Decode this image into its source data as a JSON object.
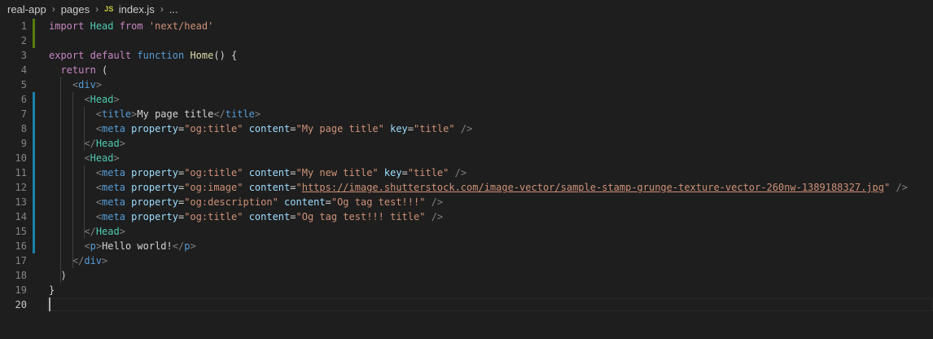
{
  "breadcrumb": {
    "folder": "real-app",
    "subfolder": "pages",
    "file_icon": "JS",
    "file": "index.js",
    "more": "..."
  },
  "editor": {
    "cursor_line": 20,
    "lines": [
      {
        "n": "1",
        "tokens": [
          [
            "kw",
            "import"
          ],
          [
            "plain",
            " "
          ],
          [
            "var",
            "Head"
          ],
          [
            "plain",
            " "
          ],
          [
            "kw",
            "from"
          ],
          [
            "plain",
            " "
          ],
          [
            "str",
            "'next/head'"
          ]
        ]
      },
      {
        "n": "2",
        "tokens": []
      },
      {
        "n": "3",
        "tokens": [
          [
            "kw",
            "export"
          ],
          [
            "plain",
            " "
          ],
          [
            "kw",
            "default"
          ],
          [
            "plain",
            " "
          ],
          [
            "fn-kw",
            "function"
          ],
          [
            "plain",
            " "
          ],
          [
            "fn",
            "Home"
          ],
          [
            "plain",
            "() {"
          ]
        ]
      },
      {
        "n": "4",
        "tokens": [
          [
            "plain",
            "  "
          ],
          [
            "kw",
            "return"
          ],
          [
            "plain",
            " ("
          ]
        ]
      },
      {
        "n": "5",
        "tokens": [
          [
            "plain",
            "    "
          ],
          [
            "punc-tag",
            "<"
          ],
          [
            "tag",
            "div"
          ],
          [
            "punc-tag",
            ">"
          ]
        ]
      },
      {
        "n": "6",
        "tokens": [
          [
            "plain",
            "      "
          ],
          [
            "punc-tag",
            "<"
          ],
          [
            "comp",
            "Head"
          ],
          [
            "punc-tag",
            ">"
          ]
        ]
      },
      {
        "n": "7",
        "tokens": [
          [
            "plain",
            "        "
          ],
          [
            "punc-tag",
            "<"
          ],
          [
            "tag",
            "title"
          ],
          [
            "punc-tag",
            ">"
          ],
          [
            "txt",
            "My page title"
          ],
          [
            "punc-tag",
            "</"
          ],
          [
            "tag",
            "title"
          ],
          [
            "punc-tag",
            ">"
          ]
        ]
      },
      {
        "n": "8",
        "tokens": [
          [
            "plain",
            "        "
          ],
          [
            "punc-tag",
            "<"
          ],
          [
            "tag",
            "meta"
          ],
          [
            "plain",
            " "
          ],
          [
            "attr",
            "property"
          ],
          [
            "plain",
            "="
          ],
          [
            "str",
            "\"og:title\""
          ],
          [
            "plain",
            " "
          ],
          [
            "attr",
            "content"
          ],
          [
            "plain",
            "="
          ],
          [
            "str",
            "\"My page title\""
          ],
          [
            "plain",
            " "
          ],
          [
            "attr",
            "key"
          ],
          [
            "plain",
            "="
          ],
          [
            "str",
            "\"title\""
          ],
          [
            "plain",
            " "
          ],
          [
            "punc-tag",
            "/>"
          ]
        ]
      },
      {
        "n": "9",
        "tokens": [
          [
            "plain",
            "      "
          ],
          [
            "punc-tag",
            "</"
          ],
          [
            "comp",
            "Head"
          ],
          [
            "punc-tag",
            ">"
          ]
        ]
      },
      {
        "n": "10",
        "tokens": [
          [
            "plain",
            "      "
          ],
          [
            "punc-tag",
            "<"
          ],
          [
            "comp",
            "Head"
          ],
          [
            "punc-tag",
            ">"
          ]
        ]
      },
      {
        "n": "11",
        "tokens": [
          [
            "plain",
            "        "
          ],
          [
            "punc-tag",
            "<"
          ],
          [
            "tag",
            "meta"
          ],
          [
            "plain",
            " "
          ],
          [
            "attr",
            "property"
          ],
          [
            "plain",
            "="
          ],
          [
            "str",
            "\"og:title\""
          ],
          [
            "plain",
            " "
          ],
          [
            "attr",
            "content"
          ],
          [
            "plain",
            "="
          ],
          [
            "str",
            "\"My new title\""
          ],
          [
            "plain",
            " "
          ],
          [
            "attr",
            "key"
          ],
          [
            "plain",
            "="
          ],
          [
            "str",
            "\"title\""
          ],
          [
            "plain",
            " "
          ],
          [
            "punc-tag",
            "/>"
          ]
        ]
      },
      {
        "n": "12",
        "tokens": [
          [
            "plain",
            "        "
          ],
          [
            "punc-tag",
            "<"
          ],
          [
            "tag",
            "meta"
          ],
          [
            "plain",
            " "
          ],
          [
            "attr",
            "property"
          ],
          [
            "plain",
            "="
          ],
          [
            "str",
            "\"og:image\""
          ],
          [
            "plain",
            " "
          ],
          [
            "attr",
            "content"
          ],
          [
            "plain",
            "="
          ],
          [
            "str",
            "\""
          ],
          [
            "url",
            "https://image.shutterstock.com/image-vector/sample-stamp-grunge-texture-vector-260nw-1389188327.jpg"
          ],
          [
            "str",
            "\""
          ],
          [
            "plain",
            " "
          ],
          [
            "punc-tag",
            "/>"
          ]
        ]
      },
      {
        "n": "13",
        "tokens": [
          [
            "plain",
            "        "
          ],
          [
            "punc-tag",
            "<"
          ],
          [
            "tag",
            "meta"
          ],
          [
            "plain",
            " "
          ],
          [
            "attr",
            "property"
          ],
          [
            "plain",
            "="
          ],
          [
            "str",
            "\"og:description\""
          ],
          [
            "plain",
            " "
          ],
          [
            "attr",
            "content"
          ],
          [
            "plain",
            "="
          ],
          [
            "str",
            "\"Og tag test!!!\""
          ],
          [
            "plain",
            " "
          ],
          [
            "punc-tag",
            "/>"
          ]
        ]
      },
      {
        "n": "14",
        "tokens": [
          [
            "plain",
            "        "
          ],
          [
            "punc-tag",
            "<"
          ],
          [
            "tag",
            "meta"
          ],
          [
            "plain",
            " "
          ],
          [
            "attr",
            "property"
          ],
          [
            "plain",
            "="
          ],
          [
            "str",
            "\"og:title\""
          ],
          [
            "plain",
            " "
          ],
          [
            "attr",
            "content"
          ],
          [
            "plain",
            "="
          ],
          [
            "str",
            "\"Og tag test!!! title\""
          ],
          [
            "plain",
            " "
          ],
          [
            "punc-tag",
            "/>"
          ]
        ]
      },
      {
        "n": "15",
        "tokens": [
          [
            "plain",
            "      "
          ],
          [
            "punc-tag",
            "</"
          ],
          [
            "comp",
            "Head"
          ],
          [
            "punc-tag",
            ">"
          ]
        ]
      },
      {
        "n": "16",
        "tokens": [
          [
            "plain",
            "      "
          ],
          [
            "punc-tag",
            "<"
          ],
          [
            "tag",
            "p"
          ],
          [
            "punc-tag",
            ">"
          ],
          [
            "txt",
            "Hello world!"
          ],
          [
            "punc-tag",
            "</"
          ],
          [
            "tag",
            "p"
          ],
          [
            "punc-tag",
            ">"
          ]
        ]
      },
      {
        "n": "17",
        "tokens": [
          [
            "plain",
            "    "
          ],
          [
            "punc-tag",
            "</"
          ],
          [
            "tag",
            "div"
          ],
          [
            "punc-tag",
            ">"
          ]
        ]
      },
      {
        "n": "18",
        "tokens": [
          [
            "plain",
            "  )"
          ]
        ]
      },
      {
        "n": "19",
        "tokens": [
          [
            "plain",
            "}"
          ]
        ]
      },
      {
        "n": "20",
        "tokens": []
      }
    ]
  },
  "colors": {
    "background": "#1e1e1e",
    "keyword": "#c586c0",
    "string": "#ce9178",
    "tag": "#569cd6",
    "component": "#4ec9b0",
    "attribute": "#9cdcfe",
    "function": "#dcdcaa",
    "git_added": "#587c0c",
    "git_modified": "#1b81a8"
  }
}
